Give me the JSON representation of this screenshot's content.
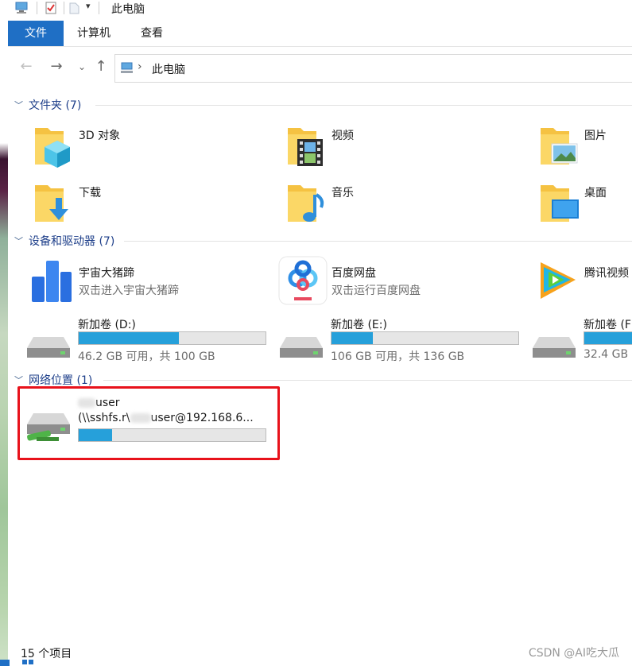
{
  "window": {
    "title": "此电脑"
  },
  "ribbon": {
    "tabs": [
      "文件",
      "计算机",
      "查看"
    ]
  },
  "nav": {
    "breadcrumb": "此电脑"
  },
  "sections": {
    "folders": {
      "title": "文件夹 (7)"
    },
    "devices": {
      "title": "设备和驱动器 (7)"
    },
    "network": {
      "title": "网络位置 (1)"
    }
  },
  "folders": [
    {
      "name": "3D 对象",
      "icon": "3d-objects-folder-icon"
    },
    {
      "name": "视频",
      "icon": "videos-folder-icon"
    },
    {
      "name": "图片",
      "icon": "pictures-folder-icon"
    },
    {
      "name": "下载",
      "icon": "downloads-folder-icon"
    },
    {
      "name": "音乐",
      "icon": "music-folder-icon"
    },
    {
      "name": "桌面",
      "icon": "desktop-folder-icon"
    }
  ],
  "apps": [
    {
      "name": "宇宙大猪蹄",
      "sub": "双击进入宇宙大猪蹄",
      "icon": "app-blue-bars-icon"
    },
    {
      "name": "百度网盘",
      "sub": "双击运行百度网盘",
      "icon": "baidu-netdisk-icon"
    },
    {
      "name": "腾讯视频",
      "sub": "",
      "icon": "tencent-video-icon"
    }
  ],
  "drives": [
    {
      "name": "新加卷 (D:)",
      "sub": "46.2 GB 可用，共 100 GB",
      "used_fraction": 0.538
    },
    {
      "name": "新加卷 (E:)",
      "sub": "106 GB 可用，共 136 GB",
      "used_fraction": 0.22
    },
    {
      "name": "新加卷 (F",
      "sub": "32.4 GB",
      "used_fraction": 0.7
    }
  ],
  "network_drive": {
    "name": "user",
    "path_prefix": "(\\\\sshfs.r\\",
    "path_suffix": "user@192.168.6...",
    "used_fraction": 0.18
  },
  "status": {
    "item_count": "15 个项目"
  },
  "watermark": "CSDN @AI吃大瓜",
  "colors": {
    "accent": "#1f6fc5",
    "bar_fill": "#26a0da",
    "highlight": "#e8121b",
    "section": "#1e3f8a"
  }
}
